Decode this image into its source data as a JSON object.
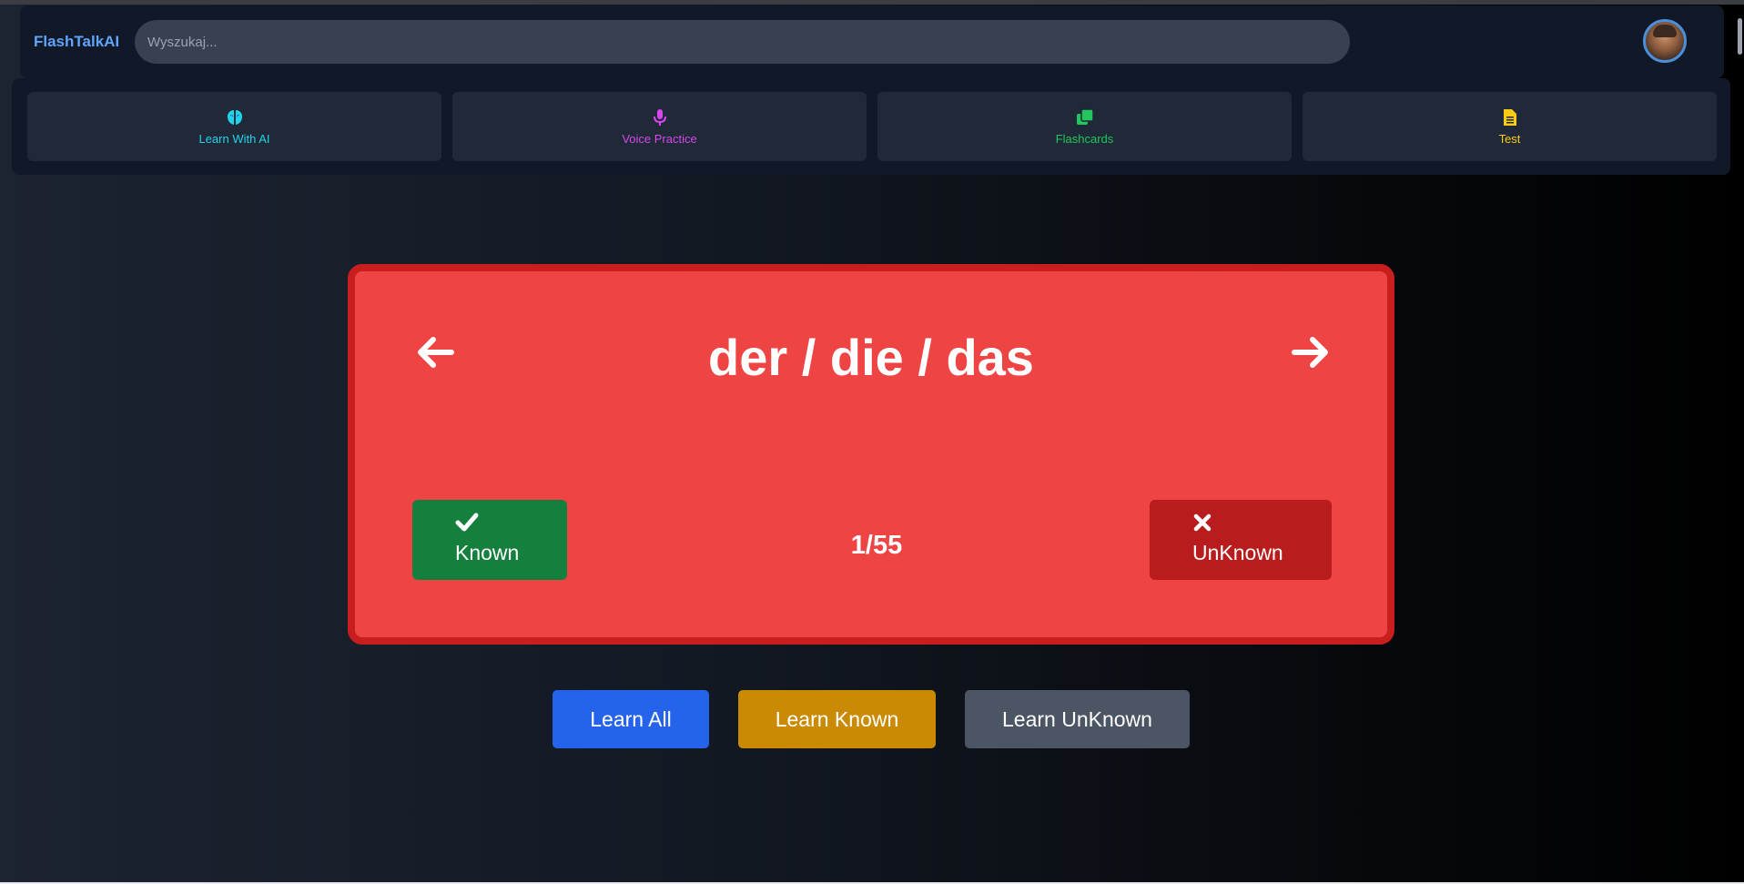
{
  "app": {
    "title": "FlashTalkAI"
  },
  "search": {
    "placeholder": "Wyszukaj..."
  },
  "nav": {
    "items": [
      {
        "label": "Learn With AI",
        "icon": "brain-icon",
        "color": "#22d3ee"
      },
      {
        "label": "Voice Practice",
        "icon": "microphone-icon",
        "color": "#d946ef"
      },
      {
        "label": "Flashcards",
        "icon": "clone-icon",
        "color": "#22c55e"
      },
      {
        "label": "Test",
        "icon": "document-icon",
        "color": "#facc15"
      }
    ]
  },
  "flashcard": {
    "word": "der / die / das",
    "counter": "1/55",
    "known_label": "Known",
    "unknown_label": "UnKnown",
    "color": "#ef4444"
  },
  "modes": {
    "learn_all": "Learn All",
    "learn_known": "Learn Known",
    "learn_unknown": "Learn UnKnown"
  },
  "colors": {
    "learn_all": "#2563eb",
    "learn_known": "#ca8a04",
    "learn_unknown": "#4b5563",
    "known": "#15803d",
    "unknown": "#b91c1c"
  }
}
